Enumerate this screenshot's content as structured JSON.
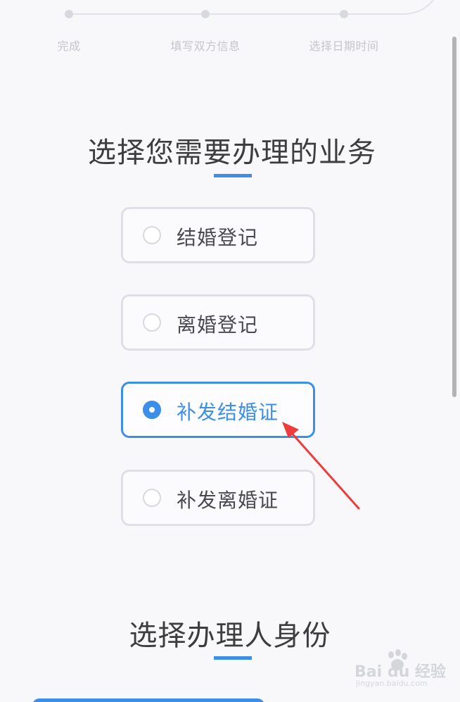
{
  "stepper": {
    "steps": [
      {
        "label": "完成"
      },
      {
        "label": "填写双方信息"
      },
      {
        "label": "选择日期时间"
      }
    ]
  },
  "business_section": {
    "title": "选择您需要办理的业务",
    "options": [
      {
        "label": "结婚登记",
        "selected": false
      },
      {
        "label": "离婚登记",
        "selected": false
      },
      {
        "label": "补发结婚证",
        "selected": true
      },
      {
        "label": "补发离婚证",
        "selected": false
      }
    ]
  },
  "identity_section": {
    "title": "选择办理人身份"
  },
  "watermark": {
    "brand": "Bai du 经验",
    "url": "jingyan.baidu.com"
  },
  "colors": {
    "accent": "#3b8fe8",
    "annotation_arrow": "#ee3b3b",
    "text": "#3d3d40",
    "muted": "#c4c6cc"
  }
}
